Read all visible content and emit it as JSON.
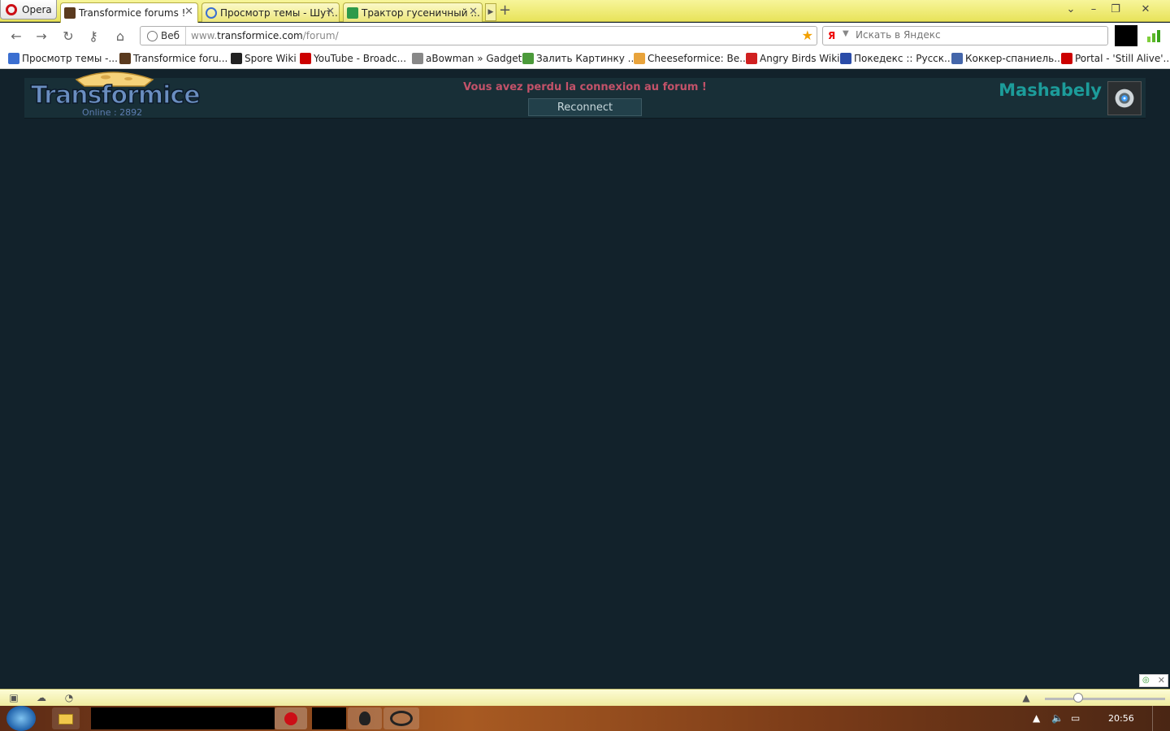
{
  "browser": {
    "opera_label": "Opera",
    "tabs": [
      {
        "label": "Transformice forums !",
        "active": true
      },
      {
        "label": "Просмотр темы - Шут..."
      },
      {
        "label": "Трактор гусеничный ..."
      }
    ],
    "address": {
      "scheme_label": "Веб",
      "url_prefix": "www.",
      "url_host": "transformice.com",
      "url_path": "/forum/"
    },
    "search_placeholder": "Искать в Яндекс",
    "search_engine_badge": "Я"
  },
  "bookmarks": [
    {
      "label": "Просмотр темы -...",
      "icon": "swirl-icon",
      "color": "#3b6fd1"
    },
    {
      "label": "Transformice foru...",
      "icon": "transformice-icon",
      "color": "#5a3a1e"
    },
    {
      "label": "Spore Wiki",
      "icon": "spore-icon",
      "color": "#222222"
    },
    {
      "label": "YouTube - Broadc...",
      "icon": "youtube-icon",
      "color": "#cc0000"
    },
    {
      "label": "aBowman » Gadgets",
      "icon": "abowman-icon",
      "color": "#888888"
    },
    {
      "label": "Залить Картинку ...",
      "icon": "image-host-icon",
      "color": "#4b9a3a"
    },
    {
      "label": "Cheeseformice: Be...",
      "icon": "cheese-icon",
      "color": "#e8a33b"
    },
    {
      "label": "Angry Birds Wiki",
      "icon": "angry-bird-icon",
      "color": "#d02020"
    },
    {
      "label": "Покедекс :: Русск...",
      "icon": "pokedex-icon",
      "color": "#2a4ca8"
    },
    {
      "label": "Коккер-спаниель...",
      "icon": "star-page-icon",
      "color": "#4466aa"
    },
    {
      "label": "Portal - 'Still Alive'...",
      "icon": "youtube-icon",
      "color": "#cc0000"
    }
  ],
  "forum": {
    "logo_text": "Transformice",
    "online_text": "Online : 2892",
    "connection_message": "Vous avez perdu la connexion au forum !",
    "reconnect_label": "Reconnect",
    "username": "Mashabely"
  },
  "taskbar": {
    "clock": "20:56"
  },
  "colors": {
    "page_bg": "#12222b",
    "header_bg": "#182f37",
    "error_text": "#c35269",
    "username": "#1c9c9a",
    "opera_red": "#cc0f16"
  }
}
